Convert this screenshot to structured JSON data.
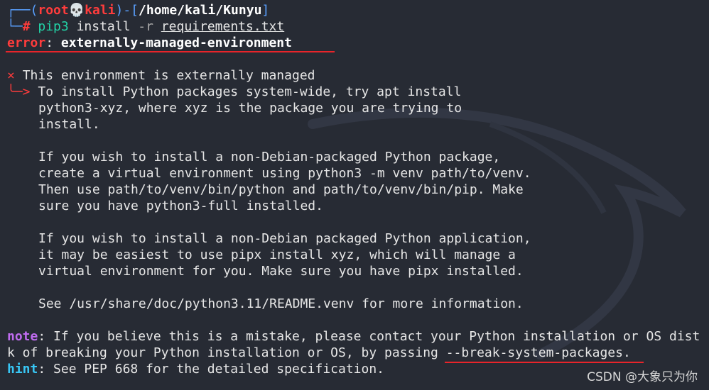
{
  "prompt": {
    "corner_top": "┌──(",
    "user": "root",
    "skull": "💀",
    "host": "kali",
    "sep": ")-[",
    "path": "/home/kali/Kunyu",
    "close": "]",
    "corner_bottom": "└─",
    "hash": "#",
    "cmd": "pip3",
    "cmd_rest1": " install ",
    "flag": "-r",
    "space": " ",
    "arg": "requirements.txt"
  },
  "error": {
    "label": "error",
    "colon": ": ",
    "message": "externally-managed-environment"
  },
  "details": {
    "x_mark": "×",
    "heading": "This environment is externally managed",
    "arrow": "╰─>",
    "lines": [
      "To install Python packages system-wide, try apt install",
      "python3-xyz, where xyz is the package you are trying to",
      "install.",
      "If you wish to install a non-Debian-packaged Python package,",
      "create a virtual environment using python3 -m venv path/to/venv.",
      "Then use path/to/venv/bin/python and path/to/venv/bin/pip. Make",
      "sure you have python3-full installed.",
      "If you wish to install a non-Debian packaged Python application,",
      "it may be easiest to use pipx install xyz, which will manage a",
      "virtual environment for you. Make sure you have pipx installed.",
      "See /usr/share/doc/python3.11/README.venv for more information."
    ]
  },
  "note": {
    "label": "note",
    "text": ": If you believe this is a mistake, please contact your Python installation or OS dist",
    "continuation": "k of breaking your Python installation or OS, by passing ",
    "flag": "--break-system-packages",
    "end": "."
  },
  "hint": {
    "label": "hint",
    "text": ": See PEP 668 for the detailed specification."
  },
  "watermark": "CSDN @大象只为你",
  "colors": {
    "background": "#272b34",
    "annotation": "#e8242a",
    "prompt_blue": "#5aa0ff",
    "error_red": "#ff3c3c",
    "command_green": "#22d3a6",
    "note_purple": "#c06cf0",
    "hint_cyan": "#38c6f4"
  }
}
